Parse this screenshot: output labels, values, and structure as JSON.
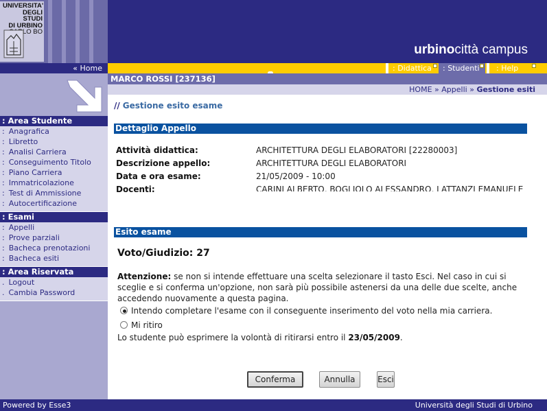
{
  "logo": {
    "lines": [
      "UNIVERSITA'",
      "DEGLI STUDI",
      "DI URBINO",
      "CARLO BO"
    ]
  },
  "brand": {
    "bold": "urbino",
    "rest": "città campus"
  },
  "nav": {
    "home_label": "« Home",
    "tabs": [
      {
        "label": ": Didattica"
      },
      {
        "label": ": Studenti"
      },
      {
        "label": ": Help"
      }
    ]
  },
  "user": {
    "name": "MARCO ROSSI [237136]"
  },
  "breadcrumb": {
    "home": "HOME",
    "sep1": "»",
    "appelli": "Appelli",
    "sep2": "»",
    "current": "Gestione esiti"
  },
  "sidebar": {
    "sections": [
      {
        "title": ": Area Studente",
        "items": [
          {
            "bullet": ":",
            "label": "Anagrafica"
          },
          {
            "bullet": ":",
            "label": "Libretto"
          },
          {
            "bullet": ":",
            "label": "Analisi Carriera"
          },
          {
            "bullet": ":",
            "label": "Conseguimento Titolo"
          },
          {
            "bullet": ":",
            "label": "Piano Carriera"
          },
          {
            "bullet": ":",
            "label": "Immatricolazione"
          },
          {
            "bullet": ":",
            "label": "Test di Ammissione"
          },
          {
            "bullet": ":",
            "label": "Autocertificazione"
          }
        ]
      },
      {
        "title": ": Esami",
        "items": [
          {
            "bullet": ":",
            "label": "Appelli"
          },
          {
            "bullet": ":",
            "label": "Prove parziali"
          },
          {
            "bullet": ":",
            "label": "Bacheca prenotazioni"
          },
          {
            "bullet": ":",
            "label": "Bacheca esiti"
          }
        ]
      },
      {
        "title": ": Area Riservata",
        "items": [
          {
            "bullet": ".",
            "label": "Logout"
          },
          {
            "bullet": ".",
            "label": "Cambia Password"
          }
        ]
      }
    ]
  },
  "page": {
    "title_prefix": "//",
    "title": "Gestione esito esame",
    "detail_section": "Dettaglio Appello",
    "details": [
      {
        "label": "Attività didattica:",
        "value": "ARCHITETTURA DEGLI ELABORATORI [22280003]"
      },
      {
        "label": "Descrizione appello:",
        "value": "ARCHITETTURA DEGLI ELABORATORI"
      },
      {
        "label": "Data e ora esame:",
        "value": "21/05/2009 - 10:00"
      },
      {
        "label": "Docenti:",
        "value": "CARINI ALBERTO, BOGLIOLO ALESSANDRO, LATTANZI EMANUELE,"
      }
    ],
    "outcome_section": "Esito esame",
    "vote_label": "Voto/Giudizio:",
    "vote_value": "27",
    "warning_bold": "Attenzione:",
    "warning_text": "se non si intende effettuare una scelta selezionare il tasto Esci. Nel caso in cui si sceglie e si conferma un'opzione, non sarà più possibile astenersi da una delle due scelte, anche accedendo nuovamente a questa pagina.",
    "options": [
      {
        "label": "Intendo completare l'esame con il conseguente inserimento del voto nella mia carriera.",
        "selected": true
      },
      {
        "label": "Mi ritiro",
        "selected": false
      }
    ],
    "deadline_text": "Lo studente può esprimere la volontà di ritirarsi entro il",
    "deadline_date": "23/05/2009",
    "deadline_end": ".",
    "buttons": {
      "confirm": "Conferma",
      "cancel": "Annulla",
      "exit": "Esci"
    }
  },
  "footer": {
    "left": "Powered by Esse3",
    "right": "Università degli Studi di Urbino"
  },
  "colors": {
    "brand_dark": "#2c2a82",
    "accent_yellow": "#ffcc00",
    "section_blue": "#0a52a0",
    "sidebar_bg": "#d6d5ea"
  }
}
